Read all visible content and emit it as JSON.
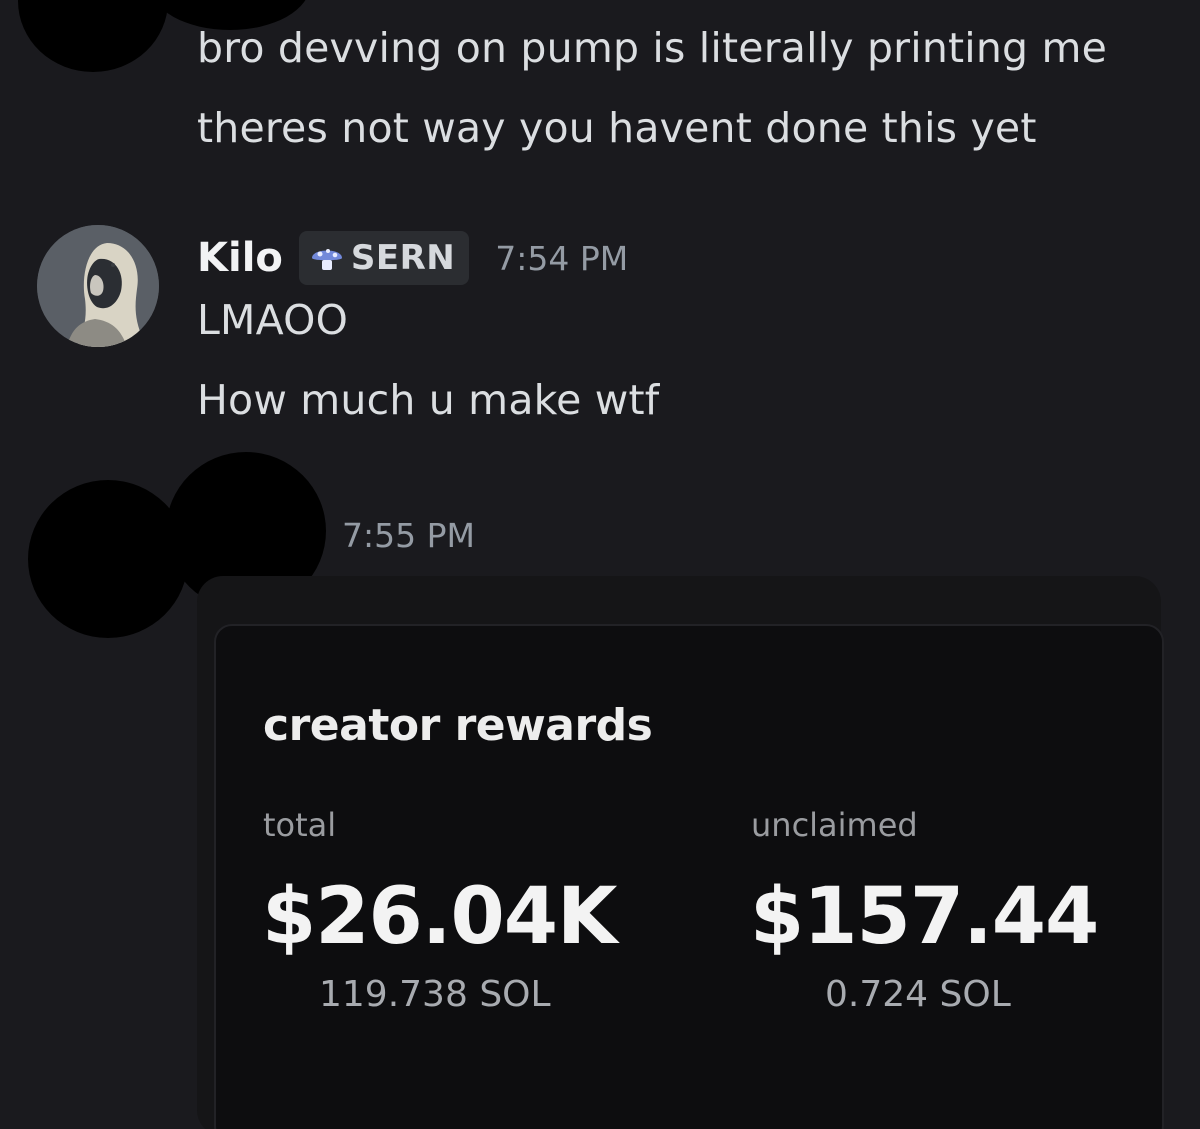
{
  "messages_top": {
    "line1": "bro devving on pump is literally printing me",
    "line2": "theres not way you havent done this yet"
  },
  "kilo_message": {
    "author": "Kilo",
    "tag": "SERN",
    "tag_icon": "mushroom-icon",
    "timestamp": "7:54 PM",
    "lines": [
      "LMAOO",
      "How much u make wtf"
    ]
  },
  "reply_message": {
    "timestamp": "7:55 PM"
  },
  "rewards_card": {
    "title": "creator rewards",
    "total_label": "total",
    "total_value": "$26.04K",
    "total_sol": "119.738 SOL",
    "unclaimed_label": "unclaimed",
    "unclaimed_value": "$157.44",
    "unclaimed_sol": "0.724 SOL"
  },
  "colors": {
    "background": "#1a1a1e",
    "text": "#dbdee1",
    "muted": "#949ba4",
    "tag_bg": "#2b2d31",
    "card_bg": "#0d0d0f"
  }
}
